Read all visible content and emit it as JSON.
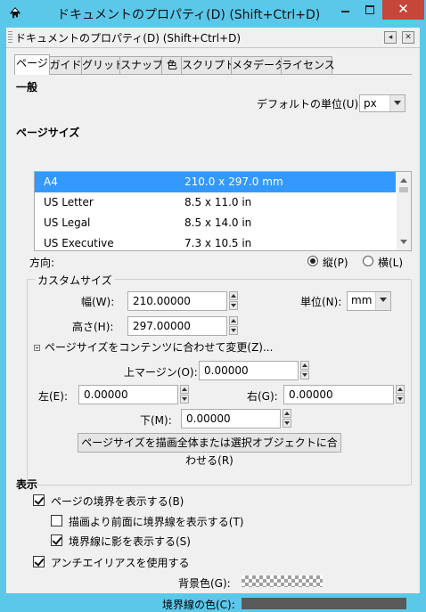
{
  "window": {
    "title": "ドキュメントのプロパティ(D) (Shift+Ctrl+D)",
    "close_glyph": "✕"
  },
  "dock": {
    "title": "ドキュメントのプロパティ(D) (Shift+Ctrl+D)",
    "btn_float_glyph": "◂",
    "btn_close_glyph": "✕"
  },
  "tabs": [
    {
      "label": "ページ"
    },
    {
      "label": "ガイド"
    },
    {
      "label": "グリッド"
    },
    {
      "label": "スナップ"
    },
    {
      "label": "色"
    },
    {
      "label": "スクリプト"
    },
    {
      "label": "メタデータ"
    },
    {
      "label": "ライセンス"
    }
  ],
  "general": {
    "heading": "一般",
    "default_unit_label": "デフォルトの単位(U):",
    "default_unit_value": "px"
  },
  "page_size": {
    "heading": "ページサイズ",
    "rows": [
      {
        "name": "A4",
        "size": "210.0 x 297.0 mm",
        "selected": true
      },
      {
        "name": "US Letter",
        "size": "8.5 x 11.0 in"
      },
      {
        "name": "US Legal",
        "size": "8.5 x 14.0 in"
      },
      {
        "name": "US Executive",
        "size": "7.3 x 10.5 in"
      }
    ]
  },
  "orientation": {
    "label": "方向:",
    "portrait": "縦(P)",
    "landscape": "横(L)"
  },
  "custom": {
    "title": "カスタムサイズ",
    "width_label": "幅(W):",
    "width_value": "210.00000",
    "height_label": "高さ(H):",
    "height_value": "297.00000",
    "unit_label": "単位(N):",
    "unit_value": "mm",
    "fit_expander": "ページサイズをコンテンツに合わせて変更(Z)...",
    "margin_top_label": "上マージン(O):",
    "margin_top_value": "0.00000",
    "margin_left_label": "左(E):",
    "margin_left_value": "0.00000",
    "margin_right_label": "右(G):",
    "margin_right_value": "0.00000",
    "margin_bottom_label": "下(M):",
    "margin_bottom_value": "0.00000",
    "fit_button": "ページサイズを描画全体または選択オブジェクトに合わせる(R)"
  },
  "display": {
    "heading": "表示",
    "show_border": "ページの境界を表示する(B)",
    "border_on_top": "描画より前面に境界線を表示する(T)",
    "border_shadow": "境界線に影を表示する(S)",
    "antialias": "アンチエイリアスを使用する",
    "bg_color_label": "背景色(G):",
    "border_color_label": "境界線の色(C):",
    "border_color": "#5a5a5a"
  }
}
